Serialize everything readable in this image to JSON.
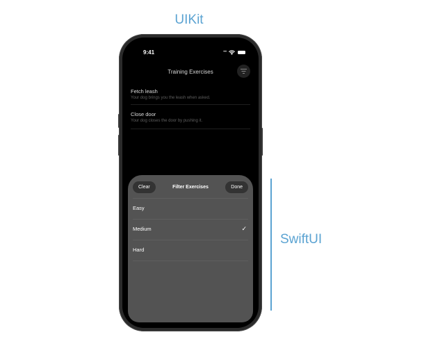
{
  "annotations": {
    "top_label": "UIKit",
    "side_label": "SwiftUI",
    "accent_color": "#5ba3d2"
  },
  "status_bar": {
    "time": "9:41",
    "icons": [
      "signal-dots-icon",
      "wifi-icon",
      "battery-icon"
    ]
  },
  "nav": {
    "title": "Training Exercises",
    "filter_icon": "filter-lines-icon"
  },
  "exercises": [
    {
      "title": "Fetch leash",
      "subtitle": "Your dog brings you the leash when asked."
    },
    {
      "title": "Close door",
      "subtitle": "Your dog closes the door by pushing it."
    }
  ],
  "sheet": {
    "title": "Filter Exercises",
    "clear_label": "Clear",
    "done_label": "Done",
    "options": [
      {
        "label": "Easy",
        "selected": false
      },
      {
        "label": "Medium",
        "selected": true
      },
      {
        "label": "Hard",
        "selected": false
      }
    ],
    "check_glyph": "✓"
  }
}
